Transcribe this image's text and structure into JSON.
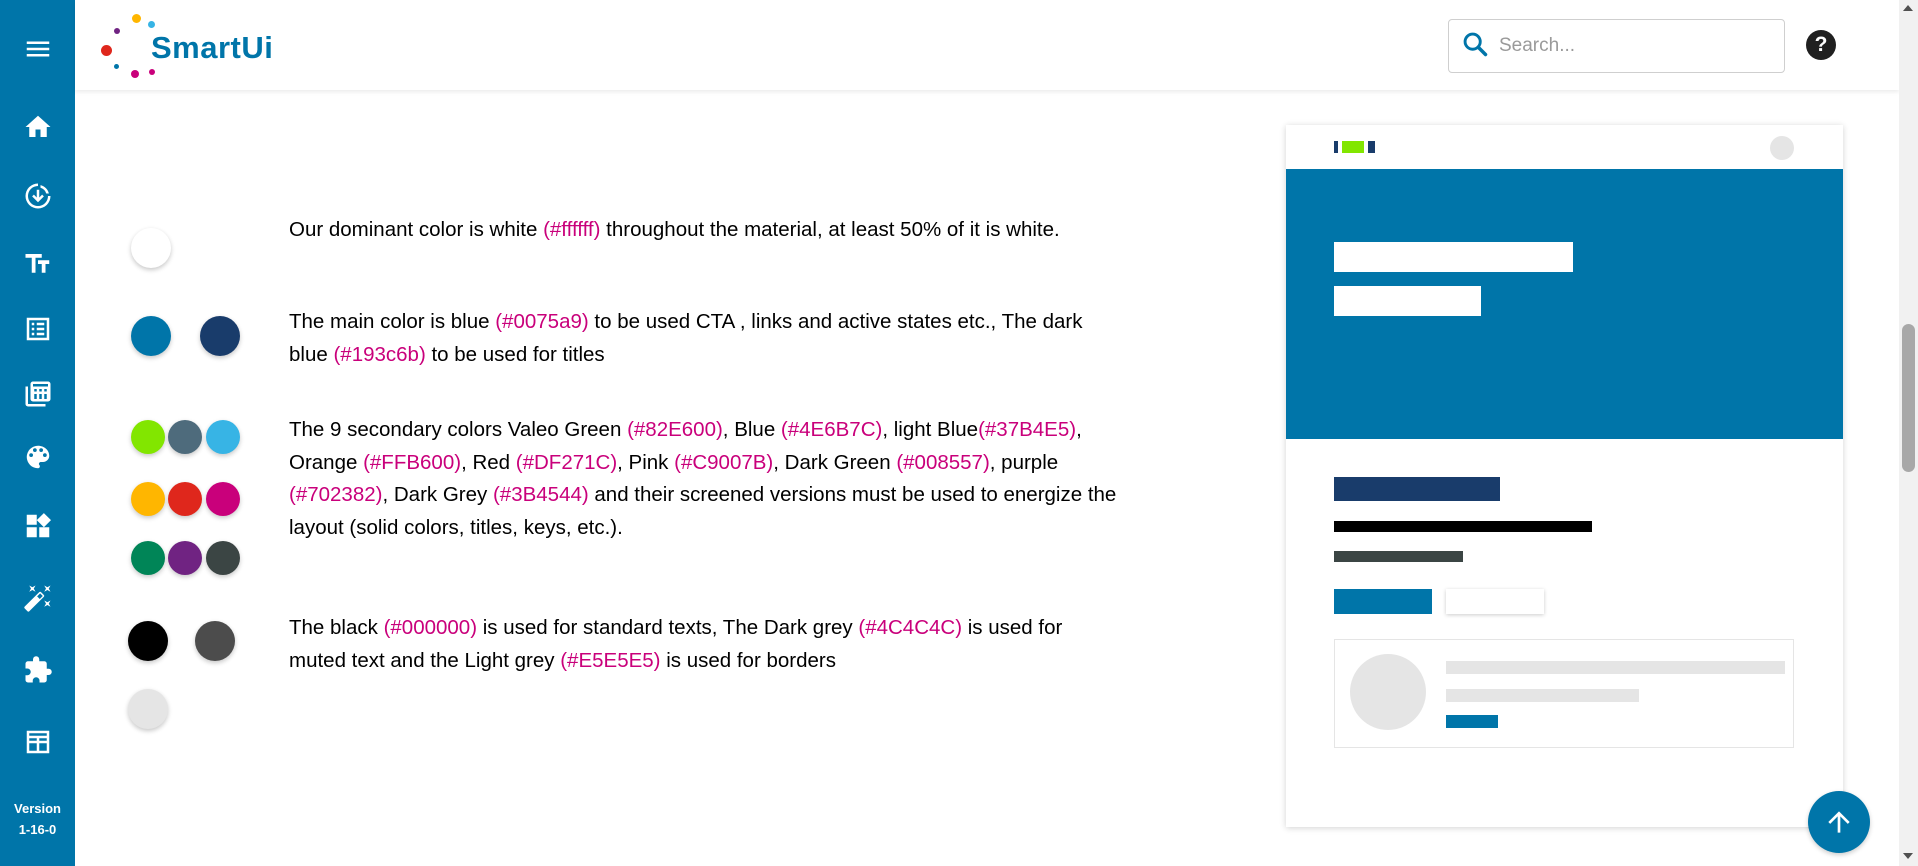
{
  "sidebar": {
    "items": [
      {
        "name": "menu-icon"
      },
      {
        "name": "home-icon"
      },
      {
        "name": "download-icon"
      },
      {
        "name": "typography-icon"
      },
      {
        "name": "list-icon"
      },
      {
        "name": "calculator-icon"
      },
      {
        "name": "palette-icon"
      },
      {
        "name": "widgets-icon"
      },
      {
        "name": "magic-wand-icon"
      },
      {
        "name": "puzzle-icon"
      },
      {
        "name": "table-icon"
      }
    ],
    "version_label": "Version",
    "version_number": "1-16-0"
  },
  "header": {
    "logo_text_1": "Smart",
    "logo_text_2": "Ui",
    "search_placeholder": "Search...",
    "help_label": "?"
  },
  "content": {
    "rows": [
      {
        "swatches": [
          "#ffffff"
        ],
        "parts": [
          "Our dominant color is white ",
          "(#ffffff)",
          " throughout the material, at least 50% of it is white."
        ]
      },
      {
        "swatches": [
          "#0075a9",
          "#193c6b"
        ],
        "parts": [
          "The main color is blue ",
          "(#0075a9)",
          " to be used CTA , links and active states etc., The dark blue ",
          "(#193c6b)",
          " to be used for titles"
        ]
      },
      {
        "swatches": [
          "#82E600",
          "#4E6B7C",
          "#37B4E5",
          "#FFB600",
          "#DF271C",
          "#C9007B",
          "#008557",
          "#702382",
          "#3B4544"
        ],
        "parts": [
          "The 9 secondary colors Valeo Green ",
          "(#82E600)",
          ", Blue ",
          "(#4E6B7C)",
          ", light Blue",
          "(#37B4E5)",
          ", Orange ",
          "(#FFB600)",
          ", Red ",
          "(#DF271C)",
          ", Pink ",
          "(#C9007B)",
          ", Dark Green ",
          "(#008557)",
          ", purple ",
          "(#702382)",
          ", Dark Grey ",
          "(#3B4544)",
          " and their screened versions must be used to energize the layout (solid colors, titles, keys, etc.)."
        ]
      },
      {
        "swatches": [
          "#000000",
          "#4C4C4C",
          "#E5E5E5"
        ],
        "parts": [
          "The black ",
          "(#000000)",
          " is used for standard texts, The Dark grey ",
          "(#4C4C4C)",
          " is used for muted text and the Light grey ",
          "(#E5E5E5)",
          " is used for borders"
        ]
      }
    ]
  },
  "colors": {
    "primary": "#0075a9",
    "dark_blue": "#193c6b",
    "accent_pink": "#c9007b",
    "green": "#82E600"
  },
  "scroll_top_icon": "arrow-up-icon"
}
